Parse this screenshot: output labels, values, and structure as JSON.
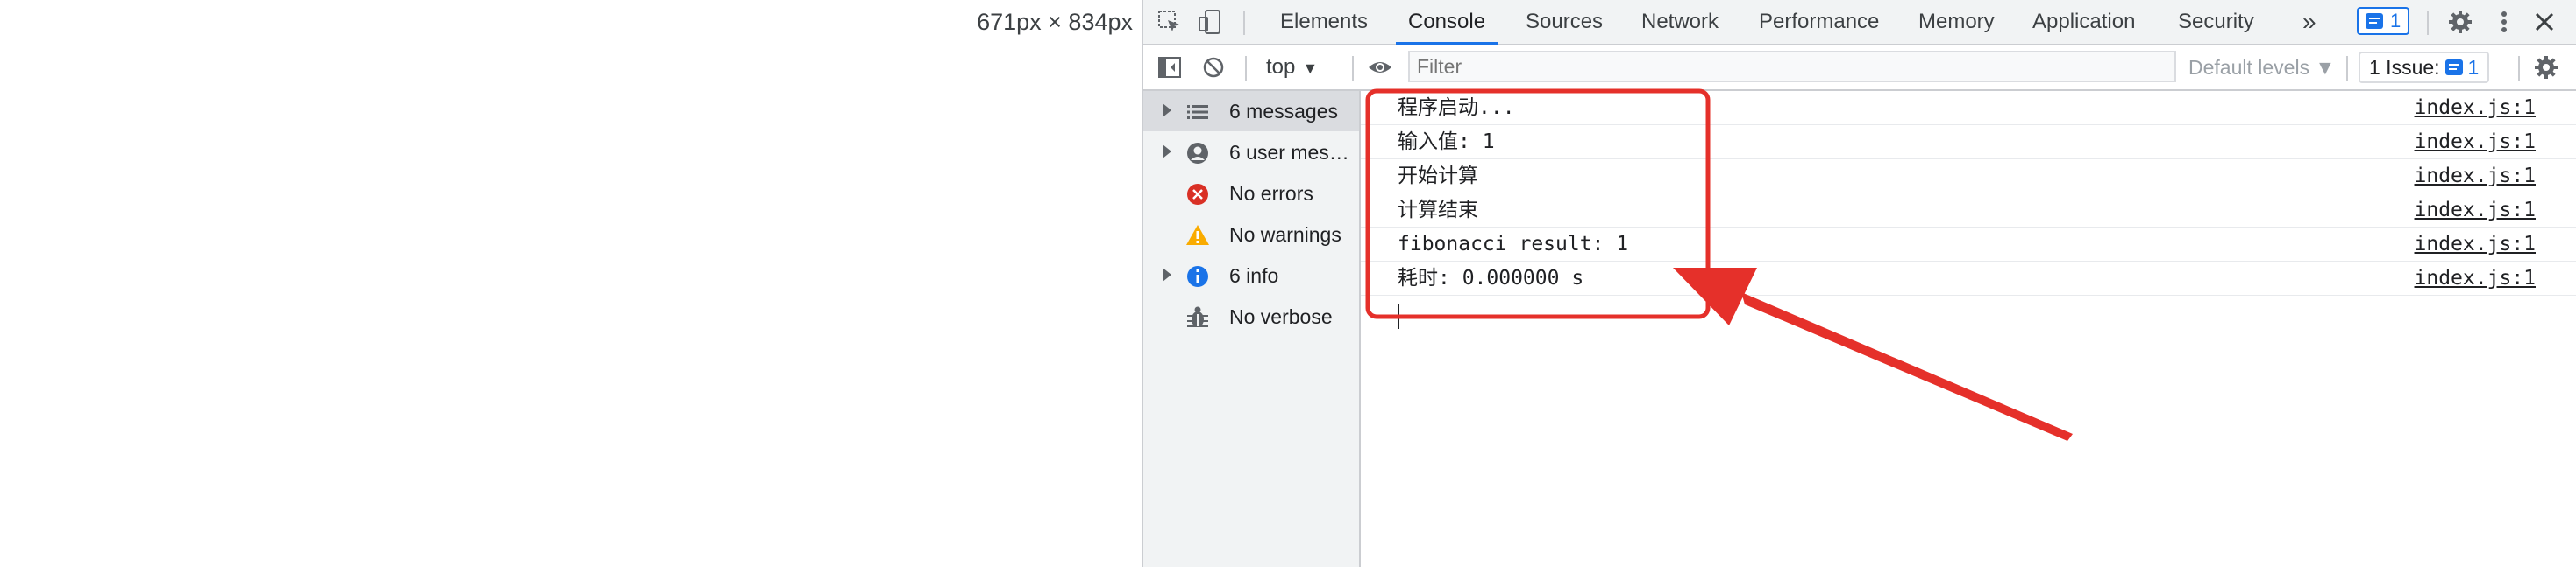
{
  "viewport_size": "671px × 834px",
  "tabs": [
    {
      "label": "Elements"
    },
    {
      "label": "Console",
      "active": true
    },
    {
      "label": "Sources"
    },
    {
      "label": "Network"
    },
    {
      "label": "Performance"
    },
    {
      "label": "Memory"
    },
    {
      "label": "Application"
    },
    {
      "label": "Security"
    }
  ],
  "tabbar": {
    "more_tabs_glyph": "»",
    "message_badge_count": "1",
    "close_glyph": "✕",
    "icons": [
      "inspect-element-icon",
      "device-toolbar-icon",
      "settings-gear-icon",
      "kebab-menu-icon",
      "close-icon"
    ]
  },
  "toolbar": {
    "context": "top",
    "filter_placeholder": "Filter",
    "default_levels": "Default levels ▼",
    "issues_label": "1 Issue:",
    "issues_count": "1",
    "icons": [
      "sidebar-toggle-icon",
      "clear-console-icon",
      "eye-icon",
      "console-settings-icon"
    ]
  },
  "sidebar": {
    "items": [
      {
        "label": "6 messages",
        "icon": "list-icon",
        "expandable": true,
        "selected": true
      },
      {
        "label": "6 user mes…",
        "icon": "user-icon",
        "expandable": true
      },
      {
        "label": "No errors",
        "icon": "error-icon",
        "expandable": false
      },
      {
        "label": "No warnings",
        "icon": "warning-icon",
        "expandable": false
      },
      {
        "label": "6 info",
        "icon": "info-icon",
        "expandable": true
      },
      {
        "label": "No verbose",
        "icon": "verbose-bug-icon",
        "expandable": false
      }
    ]
  },
  "console": {
    "messages": [
      {
        "text": "程序启动...",
        "source": "index.js:1"
      },
      {
        "text": "输入值: 1",
        "source": "index.js:1"
      },
      {
        "text": "开始计算",
        "source": "index.js:1"
      },
      {
        "text": "计算结束",
        "source": "index.js:1"
      },
      {
        "text": "fibonacci result: 1",
        "source": "index.js:1"
      },
      {
        "text": "耗时: 0.000000 s",
        "source": "index.js:1"
      }
    ]
  },
  "colors": {
    "accent": "#1a73e8",
    "annotation_red": "#e5302a",
    "error_red": "#d93025",
    "warning_yellow": "#f9ab00"
  }
}
